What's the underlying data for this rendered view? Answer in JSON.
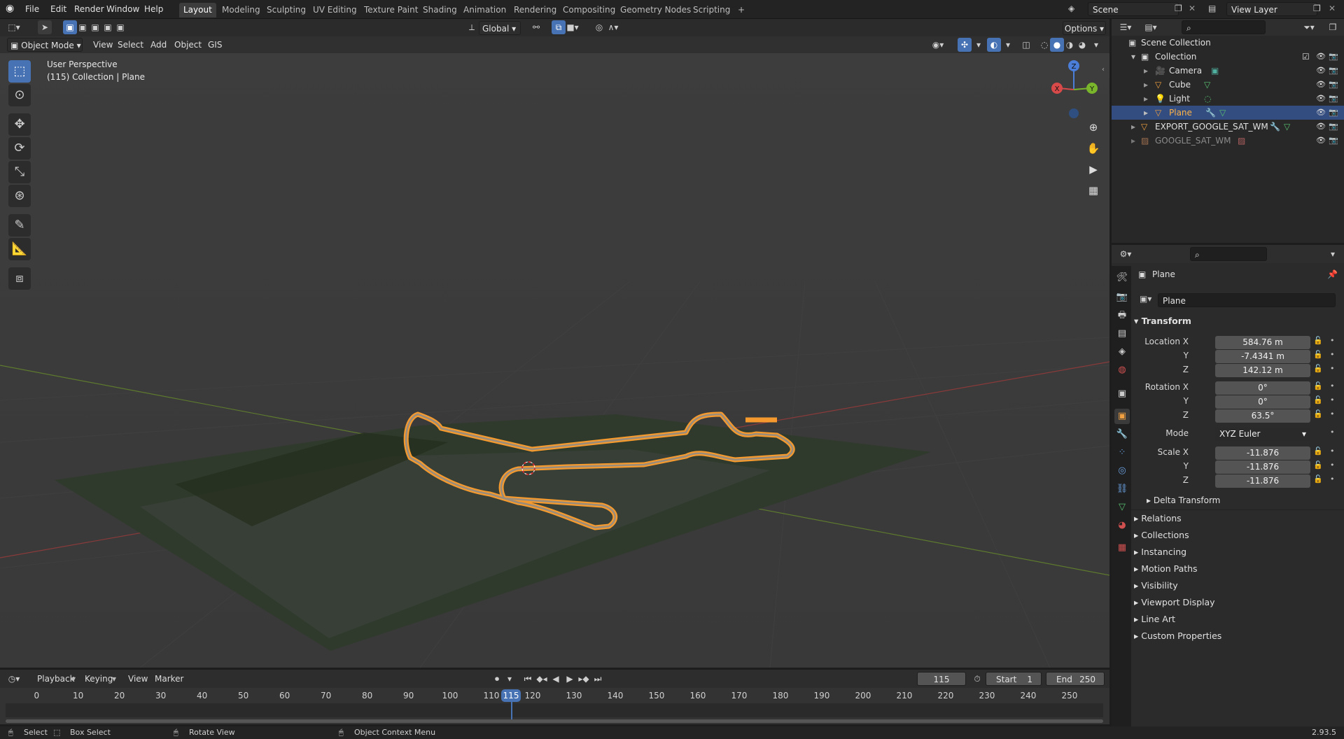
{
  "topbar": {
    "menu": [
      "File",
      "Edit",
      "Render",
      "Window",
      "Help"
    ],
    "workspaces": [
      "Layout",
      "Modeling",
      "Sculpting",
      "UV Editing",
      "Texture Paint",
      "Shading",
      "Animation",
      "Rendering",
      "Compositing",
      "Geometry Nodes",
      "Scripting"
    ],
    "add_tab": "+",
    "scene": "Scene",
    "view_layer": "View Layer"
  },
  "tool_header": {
    "orientation": "Global",
    "options": "Options"
  },
  "viewport_header": {
    "mode": "Object Mode",
    "menu": [
      "View",
      "Select",
      "Add",
      "Object",
      "GIS"
    ]
  },
  "viewport": {
    "perspective": "User Perspective",
    "context": "(115) Collection | Plane",
    "gizmo": {
      "z": "Z",
      "y": "Y",
      "x": "X"
    }
  },
  "outliner": {
    "root": "Scene Collection",
    "items": [
      {
        "name": "Collection"
      },
      {
        "name": "Camera"
      },
      {
        "name": "Cube"
      },
      {
        "name": "Light"
      },
      {
        "name": "Plane"
      },
      {
        "name": "EXPORT_GOOGLE_SAT_WM"
      },
      {
        "name": "GOOGLE_SAT_WM"
      }
    ]
  },
  "properties": {
    "object_name": "Plane",
    "datablock": "Plane",
    "transform": {
      "title": "Transform",
      "location_label": "Location X",
      "rotation_label": "Rotation X",
      "scale_label": "Scale X",
      "y": "Y",
      "z": "Z",
      "location": [
        "584.76 m",
        "-7.4341 m",
        "142.12 m"
      ],
      "rotation": [
        "0°",
        "0°",
        "63.5°"
      ],
      "mode_label": "Mode",
      "mode": "XYZ Euler",
      "scale": [
        "-11.876",
        "-11.876",
        "-11.876"
      ],
      "delta": "Delta Transform"
    },
    "sections": [
      "Relations",
      "Collections",
      "Instancing",
      "Motion Paths",
      "Visibility",
      "Viewport Display",
      "Line Art",
      "Custom Properties"
    ]
  },
  "timeline": {
    "menu": [
      "Playback",
      "Keying",
      "View",
      "Marker"
    ],
    "current_frame": "115",
    "start_label": "Start",
    "start": "1",
    "end_label": "End",
    "end": "250",
    "ticks": [
      "0",
      "10",
      "20",
      "30",
      "40",
      "50",
      "60",
      "70",
      "80",
      "90",
      "100",
      "110",
      "120",
      "130",
      "140",
      "150",
      "160",
      "170",
      "180",
      "190",
      "200",
      "210",
      "220",
      "230",
      "240",
      "250"
    ]
  },
  "statusbar": {
    "select": "Select",
    "box_select": "Box Select",
    "rotate": "Rotate View",
    "context_menu": "Object Context Menu",
    "version": "2.93.5"
  },
  "colors": {
    "accent": "#4772b3",
    "selection": "#ffa033",
    "outliner_selected": "#334d80"
  }
}
